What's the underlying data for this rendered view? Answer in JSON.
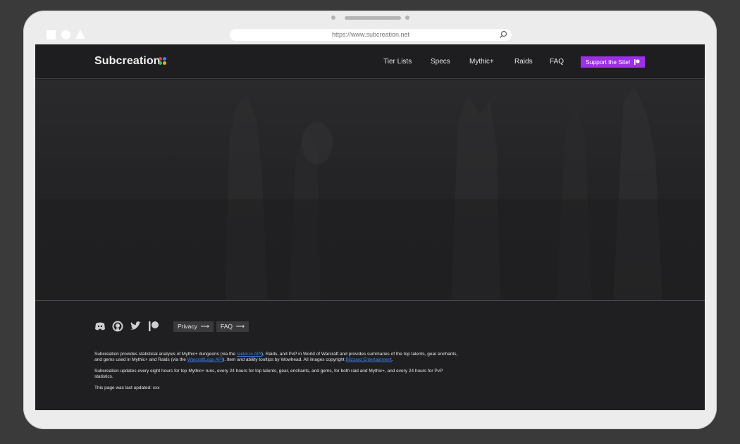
{
  "browser": {
    "url": "https://www.subcreation.net"
  },
  "nav": {
    "logo": "Subcreation",
    "links": [
      "Tier Lists",
      "Specs",
      "Mythic+",
      "Raids",
      "FAQ"
    ],
    "support_label": "Support the Site!"
  },
  "colors": {
    "accent": "#9b30e6",
    "link": "#3b82f6",
    "logo_dots": [
      "#e53e3e",
      "#3b82f6",
      "#22c55e",
      "#eab308"
    ]
  },
  "footer": {
    "social_icons": [
      "discord-icon",
      "github-icon",
      "twitter-icon",
      "patreon-icon"
    ],
    "privacy_label": "Privacy",
    "faq_label": "FAQ",
    "p1": {
      "t1": "Subcreation provides statistical analysis of Mythic+ dungeons (via the ",
      "link1": "raider.io API",
      "t2": "), Raids, and PvP in World of Warcraft and provides summaries of the top talents, gear enchants, and gems used in Mythic+ and Raids (via the ",
      "link2": "WarcraftLogs API",
      "t3": "). Item and ability tooltips by Wowhead. All images copyright ",
      "link3": "Blizzard Entertainment",
      "t4": "."
    },
    "p2": "Subcreation updates every eight hours for top Mythic+ runs, every 24 hours for top talents, gear, enchants, and gems, for both raid and Mythic+, and every 24 hours for PvP statistics.",
    "p3": "This page was last updated: xxx"
  }
}
